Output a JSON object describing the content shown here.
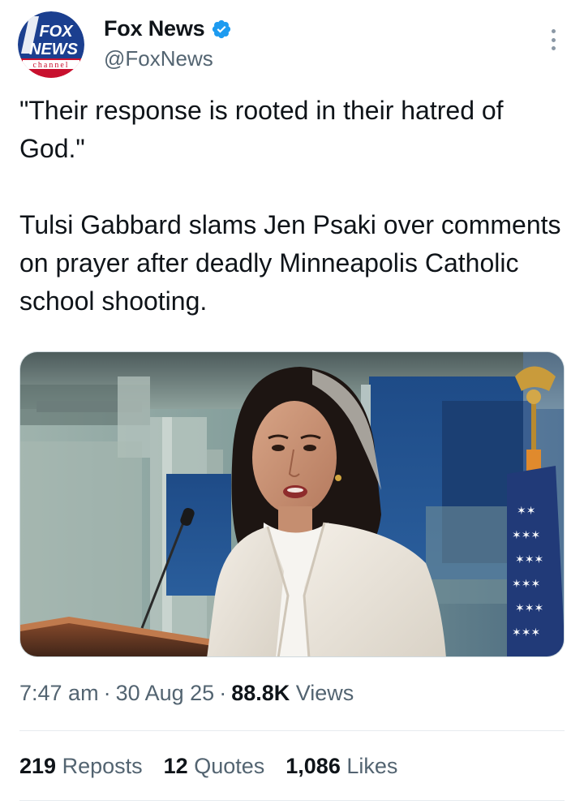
{
  "author": {
    "display_name": "Fox News",
    "handle": "@FoxNews",
    "verified": true,
    "avatar": {
      "logo_line1": "FOX",
      "logo_line2": "NEWS",
      "logo_line3": "channel"
    }
  },
  "tweet": {
    "quote_line": "\"Their response is rooted in their hatred of God.\"",
    "body": "Tulsi Gabbard slams Jen Psaki over comments on prayer after deadly Minneapolis Catholic school shooting.",
    "time": "7:47 am",
    "date": "30 Aug 25",
    "views_count": "88.8K",
    "views_label": "Views"
  },
  "stats": {
    "reposts_count": "219",
    "reposts_label": "Reposts",
    "quotes_count": "12",
    "quotes_label": "Quotes",
    "likes_count": "1,086",
    "likes_label": "Likes"
  },
  "icons": {
    "verified": "verified-badge-icon",
    "more": "more-options-icon"
  },
  "colors": {
    "verified_blue": "#1d9bf0",
    "secondary_text": "#536471",
    "primary_text": "#0f1419"
  }
}
